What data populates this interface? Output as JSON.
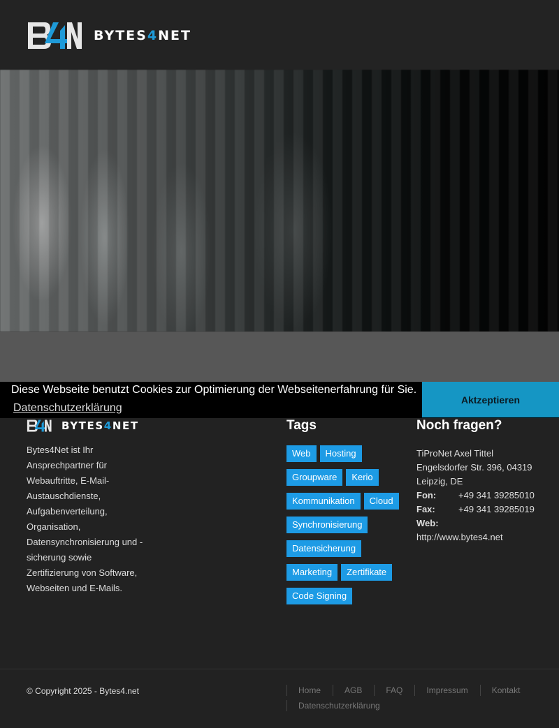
{
  "brand": {
    "name_main": "BYTES",
    "name_accent": "4",
    "name_end": "NET"
  },
  "cookie": {
    "message": "Diese Webseite benutzt Cookies zur Optimierung der Webseitenerfahrung für Sie.",
    "link": "Datenschutzerklärung",
    "accept": "Aktzeptieren"
  },
  "footer": {
    "about": "Bytes4Net ist Ihr Ansprechpartner für Webauftritte, E-Mail-Austauschdienste, Aufgabenverteilung, Organisation, Datensynchronisierung und -sicherung sowie Zertifizierung von Software, Webseiten und E-Mails.",
    "tags_title": "Tags",
    "tags": [
      [
        "Web",
        "Hosting"
      ],
      [
        "Groupware",
        "Kerio"
      ],
      [
        "Kommunikation",
        "Cloud"
      ],
      [
        "Synchronisierung"
      ],
      [
        "Datensicherung"
      ],
      [
        "Marketing",
        "Zertifikate"
      ],
      [
        "Code Signing"
      ]
    ],
    "contact_title": "Noch fragen?",
    "contact": {
      "company": "TiProNet Axel Tittel",
      "street": "Engelsdorfer Str. 396, 04319",
      "city": "Leipzig, DE",
      "phone_label": "Fon:",
      "phone": "+49 341 39285010",
      "fax_label": "Fax:",
      "fax": "+49 341 39285019",
      "web_label": "Web:",
      "web": "http://www.bytes4.net"
    },
    "copyright": "© Copyright 2025 - Bytes4.net",
    "nav": [
      "Home",
      "AGB",
      "FAQ",
      "Impressum",
      "Kontakt",
      "Datenschutzerklärung"
    ]
  },
  "colors": {
    "accent": "#1d9be5",
    "cookie_button": "#1596c4",
    "background": "#222222"
  }
}
